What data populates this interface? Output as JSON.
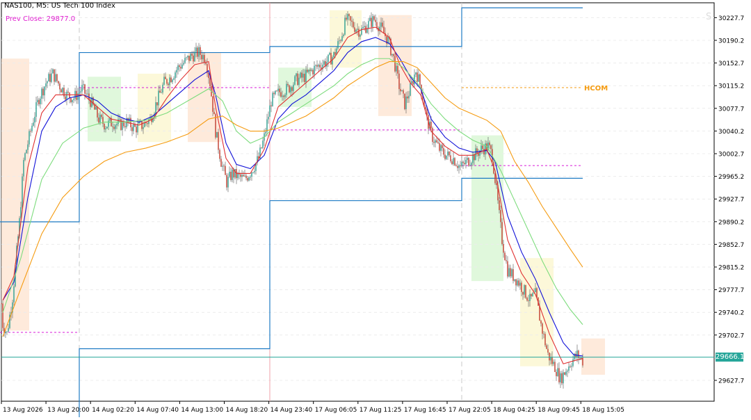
{
  "header": {
    "title": "NAS100, M5:  US Tech 100 Index",
    "prev_close": "Prev Close: 29877.0"
  },
  "corner_watermark": "S",
  "chart_data": {
    "type": "line",
    "title": "NAS100, M5:  US Tech 100 Index",
    "ylim": [
      29600,
      30260
    ],
    "y_ticks": [
      30227.7,
      30190.2,
      30152.7,
      30115.2,
      30077.7,
      30040.2,
      30002.7,
      29965.2,
      29927.7,
      29890.2,
      29852.7,
      29815.2,
      29777.7,
      29740.2,
      29702.7,
      29627.7
    ],
    "x_ticks": [
      "13 Aug 2026",
      "13 Aug 20:00",
      "14 Aug 02:20",
      "14 Aug 07:40",
      "14 Aug 13:00",
      "14 Aug 18:20",
      "14 Aug 23:40",
      "17 Aug 06:05",
      "17 Aug 11:25",
      "17 Aug 16:45",
      "17 Aug 22:05",
      "18 Aug 04:25",
      "18 Aug 09:45",
      "18 Aug 15:05"
    ],
    "price_path": [
      [
        0,
        29790
      ],
      [
        4,
        29720
      ],
      [
        10,
        29705
      ],
      [
        18,
        29765
      ],
      [
        28,
        29890
      ],
      [
        34,
        29990
      ],
      [
        40,
        30020
      ],
      [
        48,
        30060
      ],
      [
        56,
        30095
      ],
      [
        66,
        30120
      ],
      [
        76,
        30135
      ],
      [
        86,
        30115
      ],
      [
        96,
        30100
      ],
      [
        106,
        30095
      ],
      [
        118,
        30110
      ],
      [
        130,
        30090
      ],
      [
        142,
        30060
      ],
      [
        152,
        30050
      ],
      [
        162,
        30055
      ],
      [
        172,
        30050
      ],
      [
        182,
        30055
      ],
      [
        194,
        30045
      ],
      [
        206,
        30050
      ],
      [
        216,
        30060
      ],
      [
        226,
        30090
      ],
      [
        236,
        30120
      ],
      [
        246,
        30130
      ],
      [
        256,
        30145
      ],
      [
        266,
        30155
      ],
      [
        276,
        30165
      ],
      [
        286,
        30170
      ],
      [
        296,
        30160
      ],
      [
        302,
        30120
      ],
      [
        310,
        30040
      ],
      [
        318,
        29990
      ],
      [
        326,
        29955
      ],
      [
        334,
        29970
      ],
      [
        342,
        29965
      ],
      [
        352,
        29960
      ],
      [
        362,
        29975
      ],
      [
        372,
        29995
      ],
      [
        380,
        30030
      ],
      [
        390,
        30090
      ],
      [
        402,
        30105
      ],
      [
        414,
        30110
      ],
      [
        426,
        30125
      ],
      [
        438,
        30130
      ],
      [
        448,
        30140
      ],
      [
        460,
        30150
      ],
      [
        470,
        30155
      ],
      [
        480,
        30165
      ],
      [
        490,
        30195
      ],
      [
        498,
        30225
      ],
      [
        508,
        30215
      ],
      [
        518,
        30205
      ],
      [
        528,
        30215
      ],
      [
        538,
        30225
      ],
      [
        548,
        30210
      ],
      [
        558,
        30190
      ],
      [
        566,
        30160
      ],
      [
        574,
        30115
      ],
      [
        582,
        30085
      ],
      [
        590,
        30110
      ],
      [
        598,
        30140
      ],
      [
        606,
        30110
      ],
      [
        614,
        30060
      ],
      [
        622,
        30030
      ],
      [
        632,
        30010
      ],
      [
        642,
        30000
      ],
      [
        652,
        29995
      ],
      [
        662,
        29980
      ],
      [
        672,
        29990
      ],
      [
        682,
        30000
      ],
      [
        692,
        30010
      ],
      [
        702,
        30015
      ],
      [
        708,
        30000
      ],
      [
        714,
        29940
      ],
      [
        722,
        29860
      ],
      [
        730,
        29810
      ],
      [
        738,
        29800
      ],
      [
        746,
        29790
      ],
      [
        754,
        29775
      ],
      [
        762,
        29760
      ],
      [
        770,
        29770
      ],
      [
        778,
        29720
      ],
      [
        788,
        29670
      ],
      [
        798,
        29650
      ],
      [
        806,
        29630
      ],
      [
        814,
        29645
      ],
      [
        822,
        29660
      ],
      [
        830,
        29670
      ],
      [
        838,
        29660
      ]
    ],
    "series": [
      {
        "name": "",
        "color": "#1010d8",
        "values": [
          [
            4,
            29760
          ],
          [
            20,
            29790
          ],
          [
            40,
            29930
          ],
          [
            60,
            30040
          ],
          [
            80,
            30080
          ],
          [
            100,
            30095
          ],
          [
            120,
            30100
          ],
          [
            140,
            30090
          ],
          [
            160,
            30070
          ],
          [
            180,
            30060
          ],
          [
            200,
            30055
          ],
          [
            220,
            30065
          ],
          [
            240,
            30085
          ],
          [
            260,
            30105
          ],
          [
            280,
            30125
          ],
          [
            300,
            30140
          ],
          [
            310,
            30100
          ],
          [
            325,
            30020
          ],
          [
            340,
            29985
          ],
          [
            360,
            29978
          ],
          [
            380,
            30000
          ],
          [
            400,
            30060
          ],
          [
            420,
            30085
          ],
          [
            440,
            30100
          ],
          [
            460,
            30120
          ],
          [
            480,
            30140
          ],
          [
            500,
            30170
          ],
          [
            520,
            30188
          ],
          [
            540,
            30195
          ],
          [
            560,
            30185
          ],
          [
            575,
            30160
          ],
          [
            590,
            30130
          ],
          [
            605,
            30110
          ],
          [
            620,
            30060
          ],
          [
            640,
            30030
          ],
          [
            660,
            30012
          ],
          [
            680,
            30005
          ],
          [
            700,
            30008
          ],
          [
            712,
            29990
          ],
          [
            730,
            29900
          ],
          [
            750,
            29840
          ],
          [
            770,
            29795
          ],
          [
            790,
            29740
          ],
          [
            810,
            29690
          ],
          [
            825,
            29670
          ],
          [
            838,
            29668
          ]
        ]
      },
      {
        "name": "",
        "color": "#e03030",
        "values": [
          [
            4,
            29760
          ],
          [
            20,
            29800
          ],
          [
            40,
            29980
          ],
          [
            60,
            30070
          ],
          [
            80,
            30100
          ],
          [
            100,
            30100
          ],
          [
            120,
            30100
          ],
          [
            140,
            30080
          ],
          [
            160,
            30060
          ],
          [
            180,
            30055
          ],
          [
            200,
            30050
          ],
          [
            220,
            30060
          ],
          [
            240,
            30095
          ],
          [
            260,
            30125
          ],
          [
            280,
            30150
          ],
          [
            300,
            30155
          ],
          [
            310,
            30080
          ],
          [
            325,
            29995
          ],
          [
            340,
            29970
          ],
          [
            360,
            29970
          ],
          [
            380,
            30010
          ],
          [
            400,
            30080
          ],
          [
            420,
            30100
          ],
          [
            440,
            30120
          ],
          [
            460,
            30140
          ],
          [
            480,
            30160
          ],
          [
            500,
            30195
          ],
          [
            520,
            30208
          ],
          [
            540,
            30212
          ],
          [
            560,
            30195
          ],
          [
            575,
            30150
          ],
          [
            590,
            30120
          ],
          [
            605,
            30100
          ],
          [
            620,
            30040
          ],
          [
            640,
            30015
          ],
          [
            660,
            30000
          ],
          [
            680,
            30000
          ],
          [
            700,
            30010
          ],
          [
            712,
            29975
          ],
          [
            730,
            29860
          ],
          [
            750,
            29805
          ],
          [
            770,
            29770
          ],
          [
            790,
            29705
          ],
          [
            810,
            29655
          ],
          [
            825,
            29660
          ],
          [
            838,
            29664
          ]
        ]
      },
      {
        "name": "",
        "color": "#7ddc7d",
        "values": [
          [
            4,
            29740
          ],
          [
            30,
            29830
          ],
          [
            60,
            29960
          ],
          [
            90,
            30020
          ],
          [
            120,
            30045
          ],
          [
            150,
            30055
          ],
          [
            180,
            30055
          ],
          [
            210,
            30058
          ],
          [
            240,
            30070
          ],
          [
            270,
            30090
          ],
          [
            300,
            30110
          ],
          [
            320,
            30090
          ],
          [
            340,
            30040
          ],
          [
            360,
            30020
          ],
          [
            380,
            30030
          ],
          [
            400,
            30055
          ],
          [
            420,
            30070
          ],
          [
            440,
            30085
          ],
          [
            460,
            30100
          ],
          [
            480,
            30115
          ],
          [
            500,
            30135
          ],
          [
            520,
            30150
          ],
          [
            540,
            30160
          ],
          [
            560,
            30160
          ],
          [
            580,
            30145
          ],
          [
            600,
            30120
          ],
          [
            620,
            30085
          ],
          [
            640,
            30060
          ],
          [
            660,
            30040
          ],
          [
            680,
            30025
          ],
          [
            700,
            30015
          ],
          [
            720,
            29975
          ],
          [
            740,
            29925
          ],
          [
            760,
            29875
          ],
          [
            780,
            29825
          ],
          [
            800,
            29780
          ],
          [
            820,
            29745
          ],
          [
            838,
            29720
          ]
        ]
      },
      {
        "name": "",
        "color": "#f59b10",
        "values": [
          [
            4,
            29700
          ],
          [
            30,
            29780
          ],
          [
            60,
            29870
          ],
          [
            90,
            29930
          ],
          [
            120,
            29965
          ],
          [
            150,
            29990
          ],
          [
            180,
            30005
          ],
          [
            210,
            30012
          ],
          [
            240,
            30022
          ],
          [
            270,
            30035
          ],
          [
            300,
            30060
          ],
          [
            320,
            30065
          ],
          [
            340,
            30050
          ],
          [
            360,
            30040
          ],
          [
            380,
            30040
          ],
          [
            400,
            30045
          ],
          [
            420,
            30055
          ],
          [
            440,
            30065
          ],
          [
            460,
            30080
          ],
          [
            480,
            30095
          ],
          [
            500,
            30115
          ],
          [
            520,
            30130
          ],
          [
            540,
            30145
          ],
          [
            560,
            30155
          ],
          [
            580,
            30155
          ],
          [
            600,
            30145
          ],
          [
            620,
            30120
          ],
          [
            640,
            30095
          ],
          [
            660,
            30078
          ],
          [
            680,
            30068
          ],
          [
            700,
            30058
          ],
          [
            720,
            30040
          ],
          [
            740,
            29990
          ],
          [
            760,
            29955
          ],
          [
            780,
            29915
          ],
          [
            800,
            29880
          ],
          [
            820,
            29845
          ],
          [
            838,
            29815
          ]
        ]
      }
    ],
    "levels": [
      {
        "color": "#1e7bc4",
        "segments": [
          [
            0,
            29890
          ],
          [
            114,
            29890
          ],
          [
            114,
            30170
          ],
          [
            388,
            30170
          ],
          [
            388,
            30180
          ],
          [
            664,
            30180
          ],
          [
            664,
            30244
          ],
          [
            838,
            30244
          ]
        ]
      },
      {
        "color": "#1e7bc4",
        "segments": [
          [
            114,
            29560
          ],
          [
            114,
            29680
          ],
          [
            388,
            29680
          ],
          [
            388,
            29925
          ],
          [
            664,
            29925
          ],
          [
            664,
            29962
          ],
          [
            838,
            29962
          ]
        ]
      }
    ],
    "dashed_levels": [
      {
        "color": "#d81ad8",
        "from": 0,
        "to": 114,
        "y": 29707
      },
      {
        "color": "#d81ad8",
        "from": 114,
        "to": 388,
        "y": 30112
      },
      {
        "color": "#d81ad8",
        "from": 388,
        "to": 664,
        "y": 30042
      },
      {
        "color": "#d81ad8",
        "from": 664,
        "to": 838,
        "y": 29983
      },
      {
        "color": "#f59b10",
        "from": 664,
        "to": 838,
        "y": 30112,
        "label": "HCOM"
      }
    ],
    "zones": [
      {
        "color": "#fde3cf",
        "x0": 2,
        "x1": 42,
        "y0": 29710,
        "y1": 30160
      },
      {
        "color": "#d6f5d0",
        "x0": 126,
        "x1": 174,
        "y0": 30023,
        "y1": 30130
      },
      {
        "color": "#fbf6cc",
        "x0": 198,
        "x1": 246,
        "y0": 30022,
        "y1": 30135
      },
      {
        "color": "#fde3cf",
        "x0": 270,
        "x1": 318,
        "y0": 30022,
        "y1": 30170
      },
      {
        "color": "#d6f5d0",
        "x0": 400,
        "x1": 448,
        "y0": 30080,
        "y1": 30145
      },
      {
        "color": "#fbf6cc",
        "x0": 474,
        "x1": 520,
        "y0": 30145,
        "y1": 30240
      },
      {
        "color": "#fde3cf",
        "x0": 544,
        "x1": 592,
        "y0": 30065,
        "y1": 30232
      },
      {
        "color": "#d6f5d0",
        "x0": 678,
        "x1": 724,
        "y0": 29792,
        "y1": 30033
      },
      {
        "color": "#fbf6cc",
        "x0": 748,
        "x1": 796,
        "y0": 29651,
        "y1": 29830
      },
      {
        "color": "#fde3cf",
        "x0": 836,
        "x1": 870,
        "y0": 29637,
        "y1": 29697
      }
    ],
    "current_price": {
      "value": 29666.1,
      "label": "29666.1",
      "color": "#26a69a"
    },
    "session_separators": [
      114,
      388,
      664
    ],
    "red_separator": 388,
    "hcom_label": "HCOM",
    "grid": true
  }
}
